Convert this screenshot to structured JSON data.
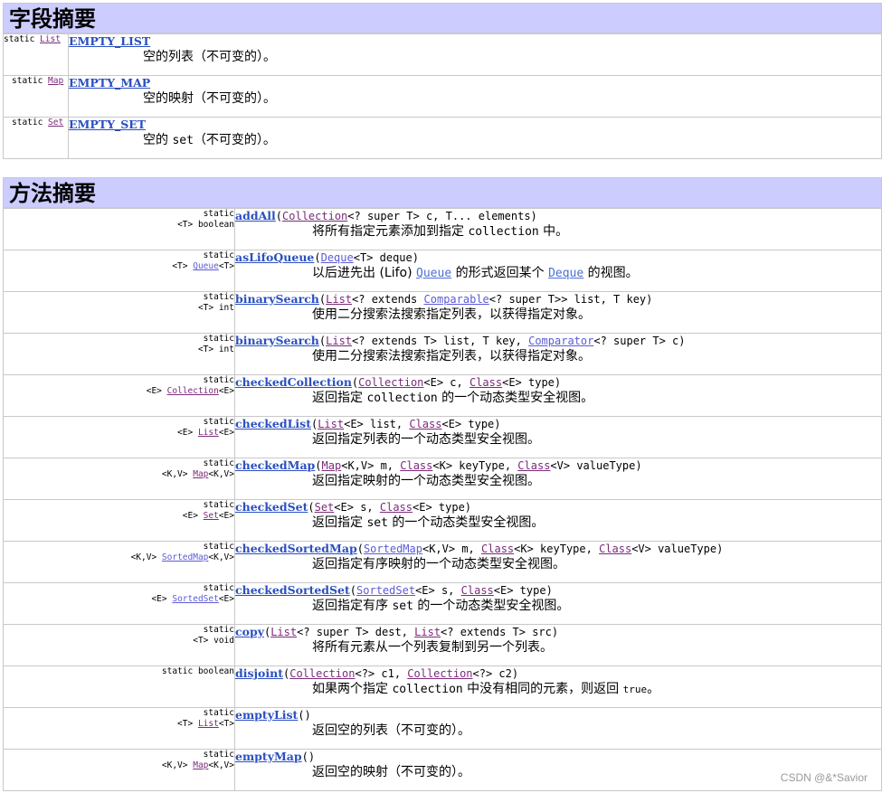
{
  "fields": {
    "title": "字段摘要",
    "rows": [
      {
        "mod": "static ",
        "type": "List",
        "name": "EMPTY_LIST",
        "desc": "空的列表（不可变的）。"
      },
      {
        "mod": "static ",
        "type": "Map",
        "name": "EMPTY_MAP",
        "desc": "空的映射（不可变的）。"
      },
      {
        "mod": "static ",
        "type": "Set",
        "name": "EMPTY_SET",
        "desc_a": "空的 ",
        "desc_code": "set",
        "desc_b": "（不可变的）。"
      }
    ]
  },
  "methods": {
    "title": "方法摘要",
    "rows": [
      {
        "mod1": "static",
        "mod2": "<T> boolean",
        "name": "addAll",
        "p1": "Collection",
        "p2": "<? super T> c, T... elements)",
        "desc_a": "将所有指定元素添加到指定 ",
        "desc_code": "collection",
        "desc_b": " 中。"
      },
      {
        "mod1": "static",
        "mod2a": "<T> ",
        "mod2link": "Queue",
        "mod2b": "<T>",
        "name": "asLifoQueue",
        "p1": "Deque",
        "p2": "<T> deque)",
        "desc_a": "以后进先出 (Lifo) ",
        "desc_link1": "Queue",
        "desc_b": " 的形式返回某个 ",
        "desc_link2": "Deque",
        "desc_c": " 的视图。"
      },
      {
        "mod1": "static",
        "mod2": "<T> int",
        "name": "binarySearch",
        "p1": "List",
        "p2": "<? extends ",
        "p3": "Comparable",
        "p4": "<? super T>> list, T key)",
        "desc": "使用二分搜索法搜索指定列表，以获得指定对象。"
      },
      {
        "mod1": "static",
        "mod2": "<T> int",
        "name": "binarySearch",
        "p1": "List",
        "p2": "<? extends T> list, T key, ",
        "p3": "Comparator",
        "p4": "<? super T> c)",
        "desc": "使用二分搜索法搜索指定列表，以获得指定对象。"
      },
      {
        "mod1": "static",
        "mod2a": "<E> ",
        "mod2link": "Collection",
        "mod2b": "<E>",
        "name": "checkedCollection",
        "p1": "Collection",
        "p2": "<E> c, ",
        "p3": "Class",
        "p4": "<E> type)",
        "desc_a": "返回指定 ",
        "desc_code": "collection",
        "desc_b": " 的一个动态类型安全视图。"
      },
      {
        "mod1": "static",
        "mod2a": "<E> ",
        "mod2link": "List",
        "mod2b": "<E>",
        "name": "checkedList",
        "p1": "List",
        "p2": "<E> list, ",
        "p3": "Class",
        "p4": "<E> type)",
        "desc": "返回指定列表的一个动态类型安全视图。"
      },
      {
        "mod1": "static",
        "mod2a": "<K,V> ",
        "mod2link": "Map",
        "mod2b": "<K,V>",
        "name": "checkedMap",
        "p1": "Map",
        "p2": "<K,V> m, ",
        "p3": "Class",
        "p4": "<K> keyType, ",
        "p5": "Class",
        "p6": "<V> valueType)",
        "desc": "返回指定映射的一个动态类型安全视图。"
      },
      {
        "mod1": "static",
        "mod2a": "<E> ",
        "mod2link": "Set",
        "mod2b": "<E>",
        "name": "checkedSet",
        "p1": "Set",
        "p2": "<E> s, ",
        "p3": "Class",
        "p4": "<E> type)",
        "desc_a": "返回指定 ",
        "desc_code": "set",
        "desc_b": " 的一个动态类型安全视图。"
      },
      {
        "mod1": "static",
        "mod2a": "<K,V> ",
        "mod2link": "SortedMap",
        "mod2b": "<K,V>",
        "name": "checkedSortedMap",
        "p1": "SortedMap",
        "p2": "<K,V> m, ",
        "p3": "Class",
        "p4": "<K> keyType, ",
        "p5": "Class",
        "p6": "<V> valueType)",
        "desc": "返回指定有序映射的一个动态类型安全视图。"
      },
      {
        "mod1": "static",
        "mod2a": "<E> ",
        "mod2link": "SortedSet",
        "mod2b": "<E>",
        "name": "checkedSortedSet",
        "p1": "SortedSet",
        "p2": "<E> s, ",
        "p3": "Class",
        "p4": "<E> type)",
        "desc_a": "返回指定有序 ",
        "desc_code": "set",
        "desc_b": " 的一个动态类型安全视图。"
      },
      {
        "mod1": "static",
        "mod2": "<T> void",
        "name": "copy",
        "p1": "List",
        "p2": "<? super T> dest, ",
        "p3": "List",
        "p4": "<? extends T> src)",
        "desc": "将所有元素从一个列表复制到另一个列表。"
      },
      {
        "mod0": "static boolean",
        "name": "disjoint",
        "p1": "Collection",
        "p2": "<?> c1, ",
        "p3": "Collection",
        "p4": "<?> c2)",
        "desc_a": "如果两个指定 ",
        "desc_code": "collection",
        "desc_b": " 中没有相同的元素，则返回 ",
        "desc_code2": "true",
        "desc_c": "。"
      },
      {
        "mod1": "static",
        "mod2a": "<T> ",
        "mod2link": "List",
        "mod2b": "<T>",
        "name": "emptyList",
        "p_end": "()",
        "desc": "返回空的列表（不可变的）。"
      },
      {
        "mod1": "static",
        "mod2a": "<K,V> ",
        "mod2link": "Map",
        "mod2b": "<K,V>",
        "name": "emptyMap",
        "p_end": "()",
        "desc": "返回空的映射（不可变的）。"
      }
    ]
  },
  "watermark": "CSDN @&*Savior"
}
